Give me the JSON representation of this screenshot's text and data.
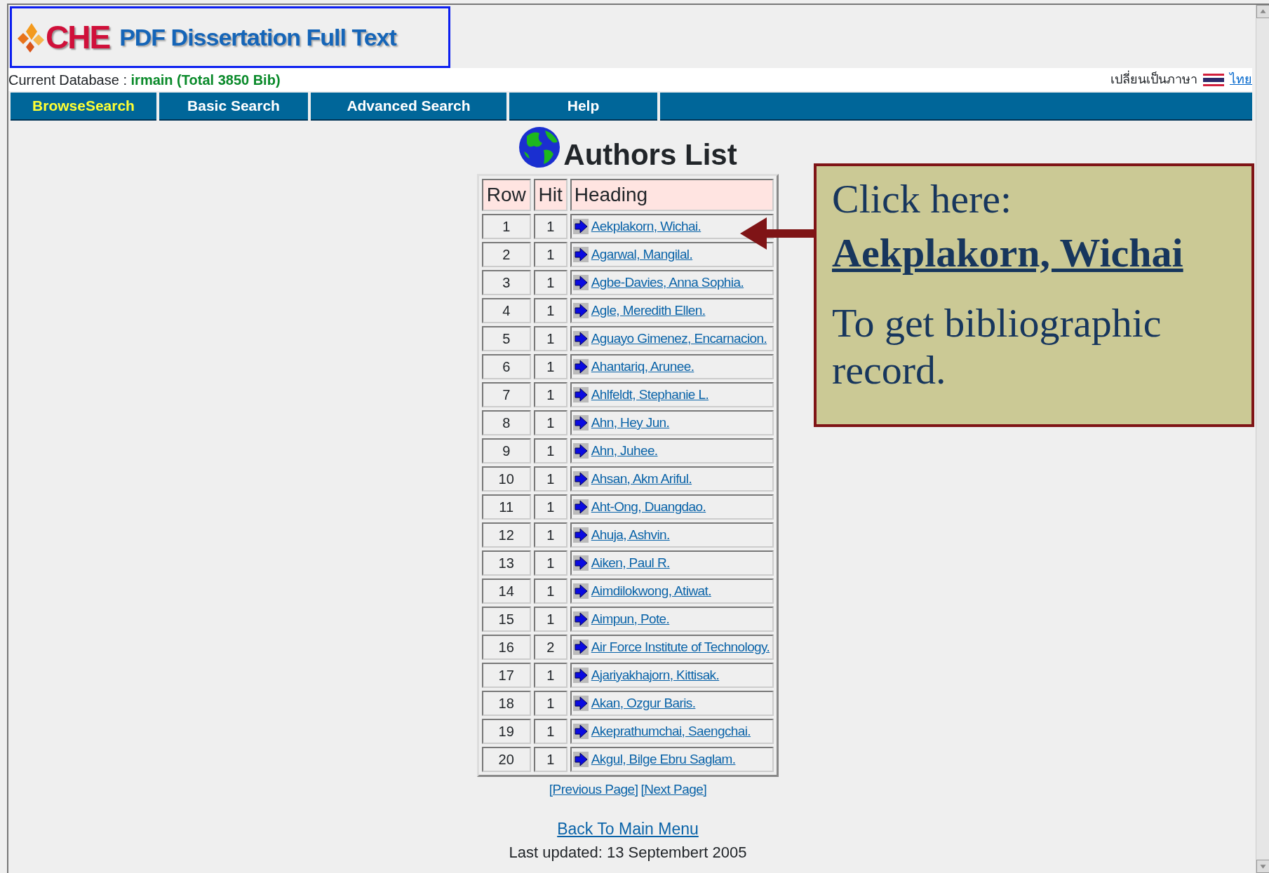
{
  "logo": {
    "mark": "CHE",
    "title": "PDF Dissertation Full Text"
  },
  "database": {
    "label": "Current Database :",
    "value": "irmain (Total 3850 Bib)"
  },
  "language_switch": {
    "label": "เปลี่ยนเป็นภาษา",
    "link": "ไทย"
  },
  "nav_tabs": [
    {
      "label": "BrowseSearch",
      "selected": true
    },
    {
      "label": "Basic Search",
      "selected": false
    },
    {
      "label": "Advanced Search",
      "selected": false
    },
    {
      "label": "Help",
      "selected": false
    }
  ],
  "page_title": "Authors List",
  "table": {
    "columns": [
      "Row",
      "Hit",
      "Heading"
    ],
    "rows": [
      {
        "row": "1",
        "hit": "1",
        "heading": "Aekplakorn, Wichai."
      },
      {
        "row": "2",
        "hit": "1",
        "heading": "Agarwal, Mangilal."
      },
      {
        "row": "3",
        "hit": "1",
        "heading": "Agbe-Davies, Anna Sophia."
      },
      {
        "row": "4",
        "hit": "1",
        "heading": "Agle, Meredith Ellen."
      },
      {
        "row": "5",
        "hit": "1",
        "heading": "Aguayo Gimenez, Encarnacion."
      },
      {
        "row": "6",
        "hit": "1",
        "heading": "Ahantariq, Arunee."
      },
      {
        "row": "7",
        "hit": "1",
        "heading": "Ahlfeldt, Stephanie L."
      },
      {
        "row": "8",
        "hit": "1",
        "heading": "Ahn, Hey Jun."
      },
      {
        "row": "9",
        "hit": "1",
        "heading": "Ahn, Juhee."
      },
      {
        "row": "10",
        "hit": "1",
        "heading": "Ahsan, Akm Ariful."
      },
      {
        "row": "11",
        "hit": "1",
        "heading": "Aht-Ong, Duangdao."
      },
      {
        "row": "12",
        "hit": "1",
        "heading": "Ahuja, Ashvin."
      },
      {
        "row": "13",
        "hit": "1",
        "heading": "Aiken, Paul R."
      },
      {
        "row": "14",
        "hit": "1",
        "heading": "Aimdilokwong, Atiwat."
      },
      {
        "row": "15",
        "hit": "1",
        "heading": "Aimpun, Pote."
      },
      {
        "row": "16",
        "hit": "2",
        "heading": "Air Force Institute of Technology."
      },
      {
        "row": "17",
        "hit": "1",
        "heading": "Ajariyakhajorn, Kittisak."
      },
      {
        "row": "18",
        "hit": "1",
        "heading": "Akan, Ozgur Baris."
      },
      {
        "row": "19",
        "hit": "1",
        "heading": "Akeprathumchai, Saengchai."
      },
      {
        "row": "20",
        "hit": "1",
        "heading": "Akgul, Bilge Ebru Saglam."
      }
    ]
  },
  "pager": [
    "[Previous Page]",
    "[Next Page]"
  ],
  "back_link": "Back To Main Menu",
  "last_updated": "Last updated: 13 Septembert 2005",
  "callout": {
    "intro": "Click here:",
    "link": "Aekplakorn, Wichai",
    "note": "To get bibliographic record."
  }
}
